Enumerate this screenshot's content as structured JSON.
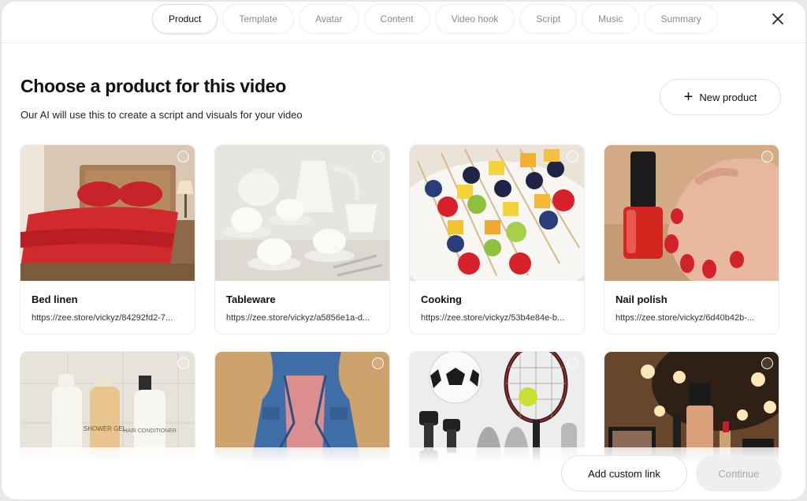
{
  "tabs": [
    {
      "label": "Product",
      "active": true
    },
    {
      "label": "Template",
      "active": false
    },
    {
      "label": "Avatar",
      "active": false
    },
    {
      "label": "Content",
      "active": false
    },
    {
      "label": "Video hook",
      "active": false
    },
    {
      "label": "Script",
      "active": false
    },
    {
      "label": "Music",
      "active": false
    },
    {
      "label": "Summary",
      "active": false
    }
  ],
  "header": {
    "title": "Choose a product for this video",
    "subtitle": "Our AI will use this to create a script and visuals for your video",
    "new_product_label": "New product"
  },
  "products": [
    {
      "name": "Bed linen",
      "url": "https://zee.store/vickyz/84292fd2-7...",
      "image": "bedroom-red-bedding"
    },
    {
      "name": "Tableware",
      "url": "https://zee.store/vickyz/a5856e1a-d...",
      "image": "white-teaset"
    },
    {
      "name": "Cooking",
      "url": "https://zee.store/vickyz/53b4e84e-b...",
      "image": "fruit-skewers"
    },
    {
      "name": "Nail polish",
      "url": "https://zee.store/vickyz/6d40b42b-...",
      "image": "red-nail-polish"
    },
    {
      "name": "",
      "url": "",
      "image": "shower-bottles",
      "bottle_labels": [
        "SHOWER GEL",
        "HAIR CONDITIONER"
      ]
    },
    {
      "name": "",
      "url": "",
      "image": "denim-jacket"
    },
    {
      "name": "",
      "url": "",
      "image": "sports-gear"
    },
    {
      "name": "",
      "url": "",
      "image": "makeup-vanity"
    }
  ],
  "footer": {
    "custom_link_label": "Add custom link",
    "continue_label": "Continue"
  },
  "colors": {
    "accent": "#111111",
    "muted": "#8a8a8a",
    "disabled_bg": "#efefef"
  }
}
